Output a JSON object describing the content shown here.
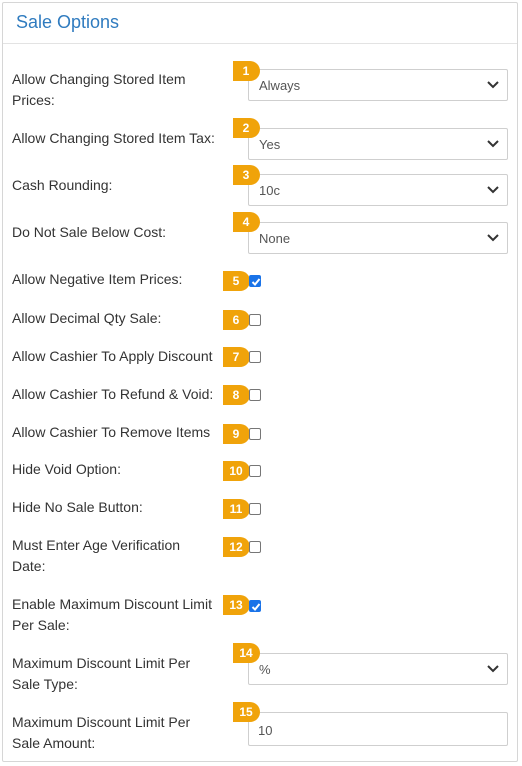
{
  "panel": {
    "title": "Sale Options"
  },
  "rows": {
    "r1": {
      "label": "Allow Changing Stored Item Prices:",
      "value": "Always",
      "badge": "1"
    },
    "r2": {
      "label": "Allow Changing Stored Item Tax:",
      "value": "Yes",
      "badge": "2"
    },
    "r3": {
      "label": "Cash Rounding:",
      "value": "10c",
      "badge": "3"
    },
    "r4": {
      "label": "Do Not Sale Below Cost:",
      "value": "None",
      "badge": "4"
    },
    "r5": {
      "label": "Allow Negative Item Prices:",
      "checked": true,
      "badge": "5"
    },
    "r6": {
      "label": "Allow Decimal Qty Sale:",
      "checked": false,
      "badge": "6"
    },
    "r7": {
      "label": "Allow Cashier To Apply Discount",
      "checked": false,
      "badge": "7"
    },
    "r8": {
      "label": "Allow Cashier To Refund & Void:",
      "checked": false,
      "badge": "8"
    },
    "r9": {
      "label": "Allow Cashier To Remove Items",
      "checked": false,
      "badge": "9"
    },
    "r10": {
      "label": "Hide Void Option:",
      "checked": false,
      "badge": "10"
    },
    "r11": {
      "label": "Hide No Sale Button:",
      "checked": false,
      "badge": "11"
    },
    "r12": {
      "label": "Must Enter Age Verification Date:",
      "checked": false,
      "badge": "12"
    },
    "r13": {
      "label": "Enable Maximum Discount Limit Per Sale:",
      "checked": true,
      "badge": "13"
    },
    "r14": {
      "label": "Maximum Discount Limit Per Sale Type:",
      "value": "%",
      "badge": "14"
    },
    "r15": {
      "label": "Maximum Discount Limit Per Sale Amount:",
      "value": "10",
      "badge": "15"
    }
  },
  "colors": {
    "accent": "#2f7bbf",
    "badge": "#f0a30a",
    "checkbox": "#1a73e8"
  },
  "icons": {
    "select": "chevron-down-icon",
    "checkbox": "checkmark-icon"
  }
}
